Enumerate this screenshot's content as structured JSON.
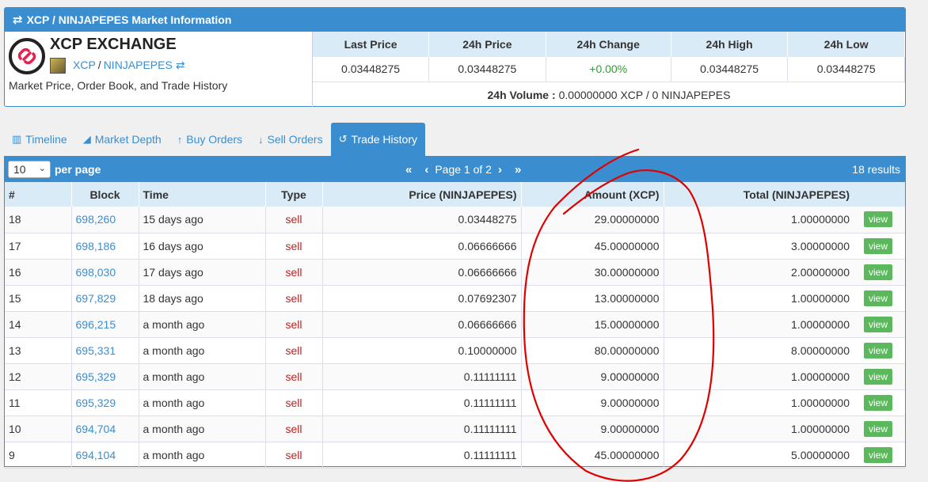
{
  "header": {
    "title": "XCP / NINJAPEPES Market Information"
  },
  "asset": {
    "exchange_name": "XCP EXCHANGE",
    "base": "XCP",
    "separator": "/",
    "quote": "NINJAPEPES",
    "description": "Market Price, Order Book, and Trade History"
  },
  "stats": {
    "headers": [
      "Last Price",
      "24h Price",
      "24h Change",
      "24h High",
      "24h Low"
    ],
    "values": [
      "0.03448275",
      "0.03448275",
      "+0.00%",
      "0.03448275",
      "0.03448275"
    ],
    "volume_label": "24h Volume :",
    "volume_value": "0.00000000 XCP / 0 NINJAPEPES"
  },
  "tabs": [
    {
      "label": "Timeline",
      "icon": "bar-chart-icon"
    },
    {
      "label": "Market Depth",
      "icon": "area-chart-icon"
    },
    {
      "label": "Buy Orders",
      "icon": "arrow-up-icon"
    },
    {
      "label": "Sell Orders",
      "icon": "arrow-down-icon"
    },
    {
      "label": "Trade History",
      "icon": "history-icon",
      "active": true
    }
  ],
  "toolbar": {
    "per_page_value": "10",
    "per_page_label": "per page",
    "page_text": "Page 1 of 2",
    "results": "18 results"
  },
  "table": {
    "headers": [
      "#",
      "Block",
      "Time",
      "Type",
      "Price (NINJAPEPES)",
      "Amount (XCP)",
      "Total (NINJAPEPES)"
    ],
    "rows": [
      {
        "num": "18",
        "block": "698,260",
        "time": "15 days ago",
        "type": "sell",
        "price": "0.03448275",
        "amount": "29.00000000",
        "total": "1.00000000",
        "action": "view"
      },
      {
        "num": "17",
        "block": "698,186",
        "time": "16 days ago",
        "type": "sell",
        "price": "0.06666666",
        "amount": "45.00000000",
        "total": "3.00000000",
        "action": "view"
      },
      {
        "num": "16",
        "block": "698,030",
        "time": "17 days ago",
        "type": "sell",
        "price": "0.06666666",
        "amount": "30.00000000",
        "total": "2.00000000",
        "action": "view"
      },
      {
        "num": "15",
        "block": "697,829",
        "time": "18 days ago",
        "type": "sell",
        "price": "0.07692307",
        "amount": "13.00000000",
        "total": "1.00000000",
        "action": "view"
      },
      {
        "num": "14",
        "block": "696,215",
        "time": "a month ago",
        "type": "sell",
        "price": "0.06666666",
        "amount": "15.00000000",
        "total": "1.00000000",
        "action": "view"
      },
      {
        "num": "13",
        "block": "695,331",
        "time": "a month ago",
        "type": "sell",
        "price": "0.10000000",
        "amount": "80.00000000",
        "total": "8.00000000",
        "action": "view"
      },
      {
        "num": "12",
        "block": "695,329",
        "time": "a month ago",
        "type": "sell",
        "price": "0.11111111",
        "amount": "9.00000000",
        "total": "1.00000000",
        "action": "view"
      },
      {
        "num": "11",
        "block": "695,329",
        "time": "a month ago",
        "type": "sell",
        "price": "0.11111111",
        "amount": "9.00000000",
        "total": "1.00000000",
        "action": "view"
      },
      {
        "num": "10",
        "block": "694,704",
        "time": "a month ago",
        "type": "sell",
        "price": "0.11111111",
        "amount": "9.00000000",
        "total": "1.00000000",
        "action": "view"
      },
      {
        "num": "9",
        "block": "694,104",
        "time": "a month ago",
        "type": "sell",
        "price": "0.11111111",
        "amount": "45.00000000",
        "total": "5.00000000",
        "action": "view"
      }
    ]
  },
  "colors": {
    "accent": "#3a8ed0",
    "header_bg": "#d9ebf7",
    "sell": "#b22222",
    "positive": "#2ea02e",
    "view_button": "#5cb85c",
    "annotation": "#e00000"
  }
}
